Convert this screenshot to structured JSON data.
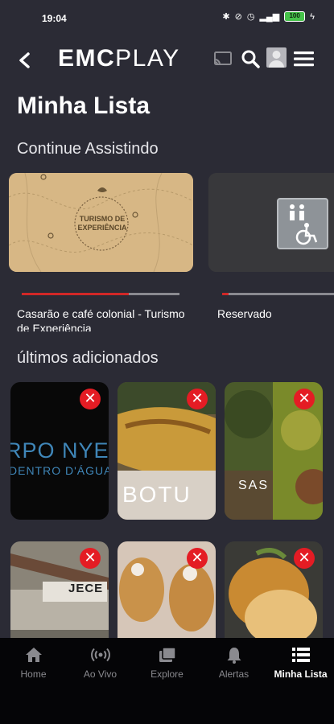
{
  "status_bar": {
    "time": "19:04",
    "battery": "100"
  },
  "header": {
    "logo_bold": "EMC",
    "logo_light": "PLAY"
  },
  "page": {
    "title": "Minha Lista"
  },
  "continue_watching": {
    "title": "Continue Assistindo",
    "items": [
      {
        "label": "Casarão e café colonial - Turismo de Experiência",
        "poster_text": "TURISMO DE EXPERIÊNCIA",
        "progress": 0.68
      },
      {
        "label": "Reservado",
        "poster_text": "",
        "progress": 0.05
      }
    ]
  },
  "recently_added": {
    "title": "últimos adicionados",
    "tiles": [
      {
        "caption": "RPO NYE",
        "subcaption": "DENTRO D'ÁGUA"
      },
      {
        "caption": "BOTU",
        "subcaption": ""
      },
      {
        "caption": "SAS",
        "subcaption": ""
      },
      {
        "caption": "JECE",
        "subcaption": ""
      },
      {
        "caption": "",
        "subcaption": ""
      },
      {
        "caption": "",
        "subcaption": ""
      }
    ],
    "remove_icon": "✕"
  },
  "bottom_nav": {
    "items": [
      {
        "label": "Home",
        "icon": "home-icon"
      },
      {
        "label": "Ao Vivo",
        "icon": "live-icon"
      },
      {
        "label": "Explore",
        "icon": "explore-icon"
      },
      {
        "label": "Alertas",
        "icon": "bell-icon"
      },
      {
        "label": "Minha Lista",
        "icon": "list-icon"
      }
    ],
    "active": "Minha Lista"
  },
  "colors": {
    "accent": "#e41c24",
    "background": "#2b2b35",
    "nav_bg": "#050507"
  }
}
